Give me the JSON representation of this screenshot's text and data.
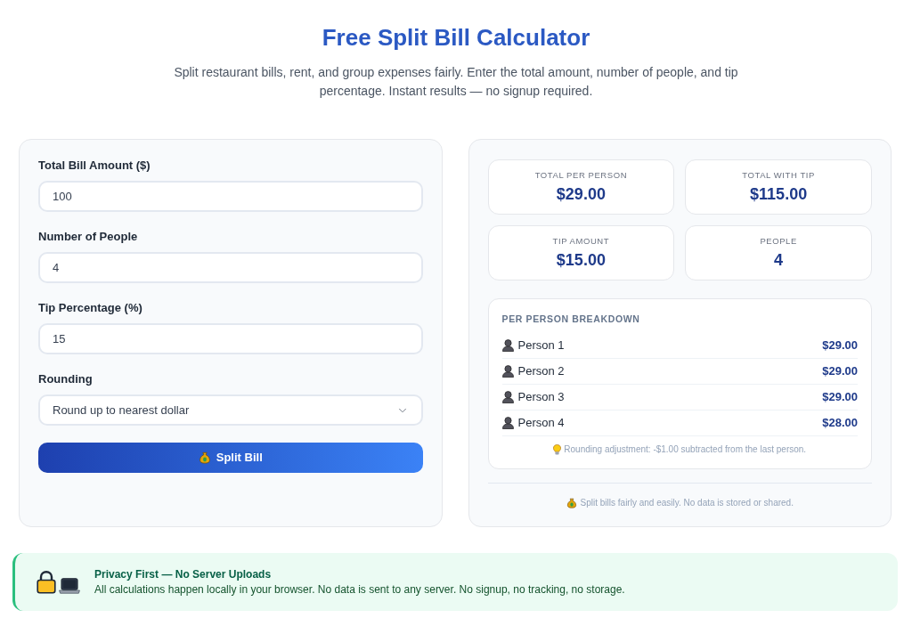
{
  "header": {
    "title": "Free Split Bill Calculator",
    "subtitle": "Split restaurant bills, rent, and group expenses fairly. Enter the total amount, number of people, and tip percentage. Instant results — no signup required."
  },
  "form": {
    "fields": [
      {
        "kind": "input",
        "label": "Total Bill Amount ($)",
        "value": "100"
      },
      {
        "kind": "input",
        "label": "Number of People",
        "value": "4"
      },
      {
        "kind": "input",
        "label": "Tip Percentage (%)",
        "value": "15"
      },
      {
        "kind": "select",
        "label": "Rounding",
        "value": "Round up to nearest dollar"
      }
    ],
    "button": {
      "label": "Split Bill"
    }
  },
  "results": {
    "stats": [
      {
        "label": "TOTAL PER PERSON",
        "value": "$29.00"
      },
      {
        "label": "TOTAL WITH TIP",
        "value": "$115.00"
      },
      {
        "label": "TIP AMOUNT",
        "value": "$15.00"
      },
      {
        "label": "PEOPLE",
        "value": "4"
      }
    ],
    "breakdown": {
      "title": "PER PERSON BREAKDOWN",
      "rows": [
        {
          "name": "Person 1",
          "amount": "$29.00"
        },
        {
          "name": "Person 2",
          "amount": "$29.00"
        },
        {
          "name": "Person 3",
          "amount": "$29.00"
        },
        {
          "name": "Person 4",
          "amount": "$28.00"
        }
      ],
      "note": "Rounding adjustment: -$1.00 subtracted from the last person."
    },
    "footer": "Split bills fairly and easily. No data is stored or shared."
  },
  "privacy": {
    "title": "Privacy First — No Server Uploads",
    "text": "All calculations happen locally in your browser. No data is sent to any server. No signup, no tracking, no storage."
  }
}
